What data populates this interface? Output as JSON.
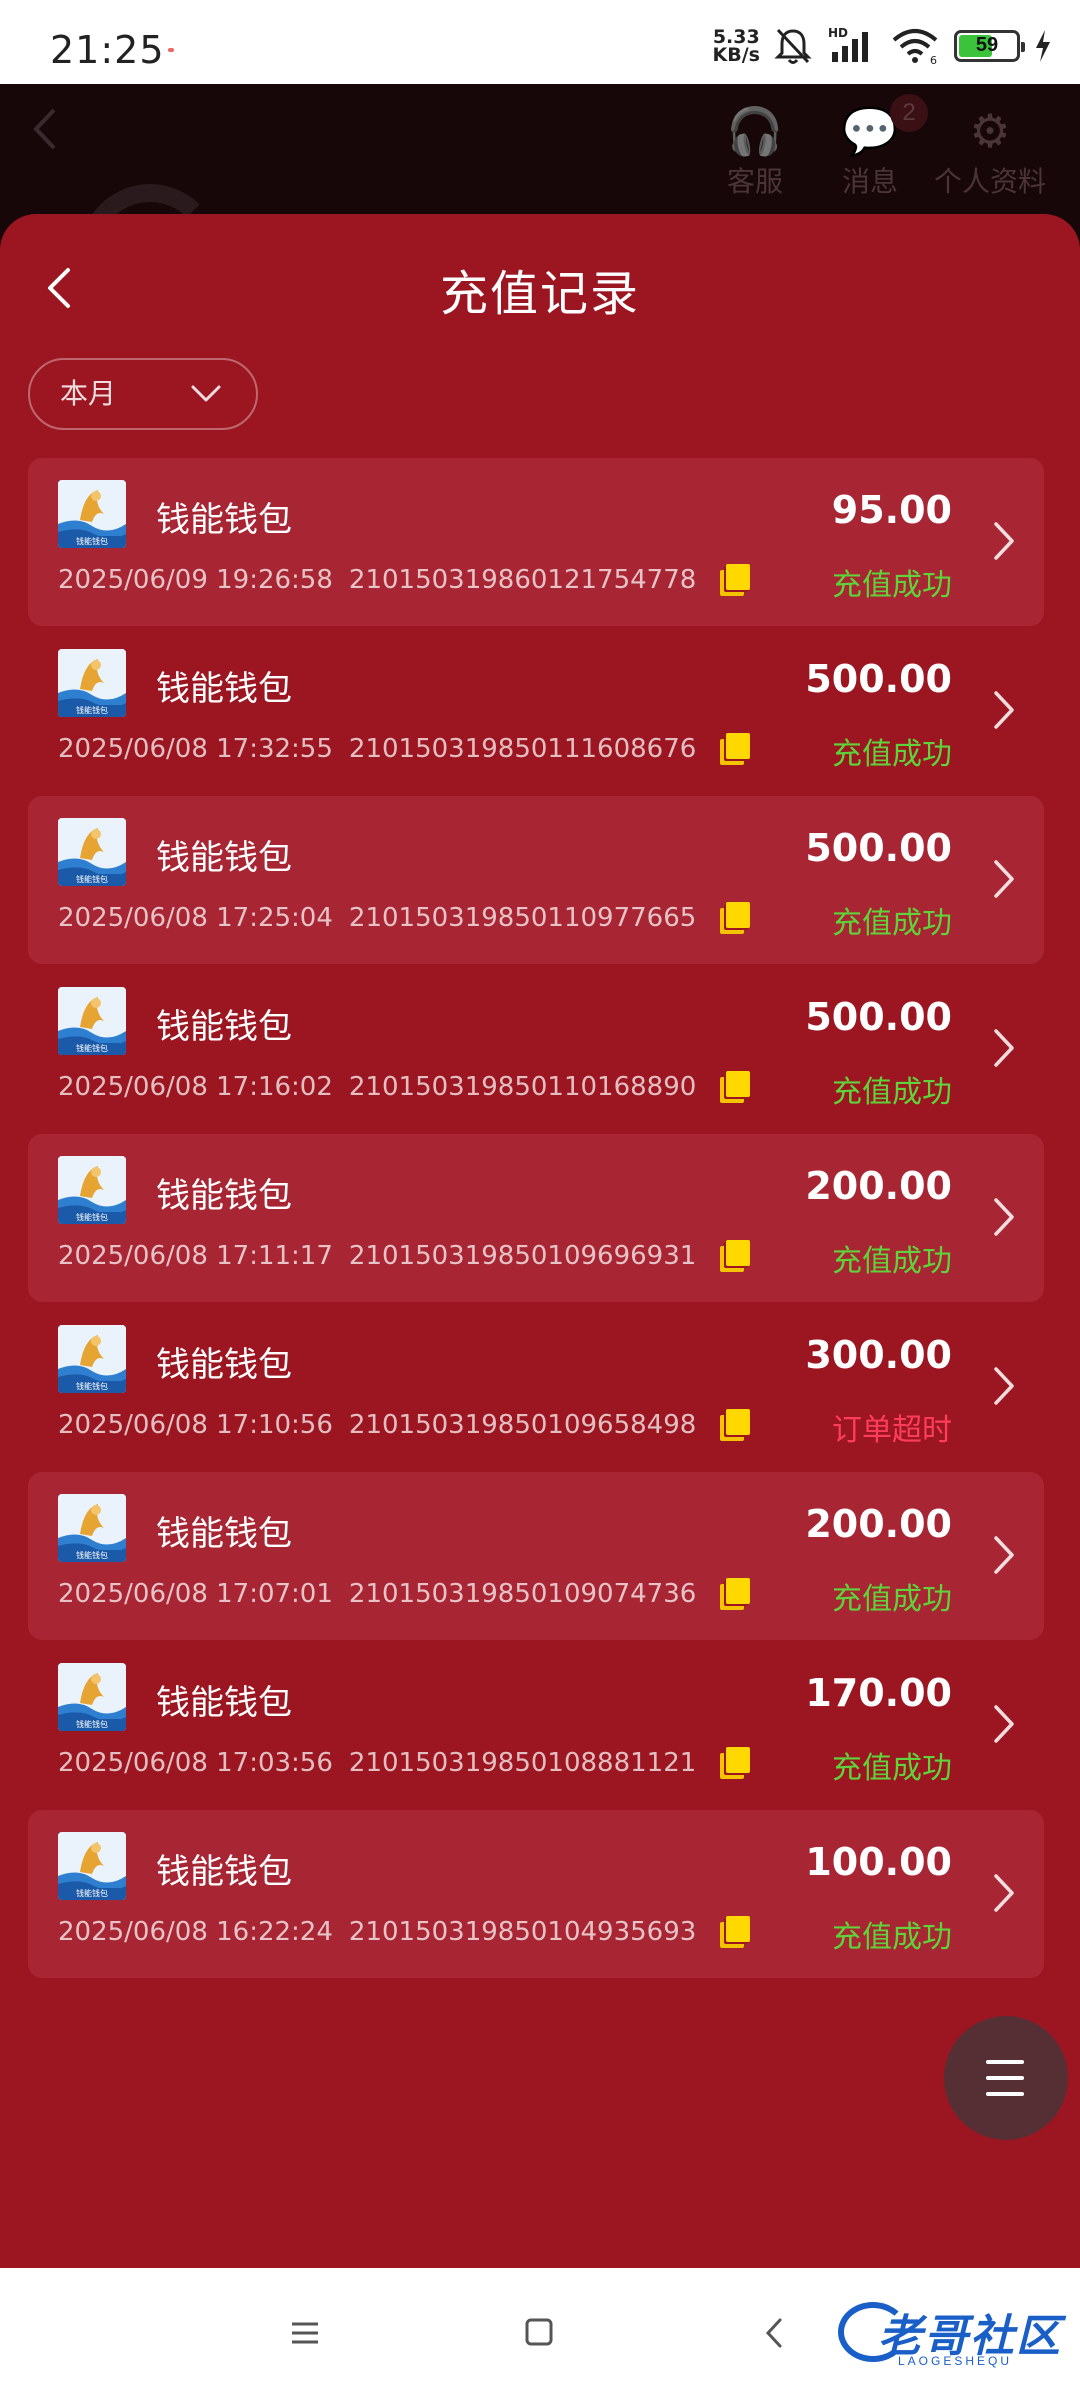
{
  "status_bar": {
    "time": "21:25",
    "net_speed_value": "5.33",
    "net_speed_unit": "KB/s",
    "hd_label": "HD",
    "battery_level": "59"
  },
  "background_page": {
    "customer_service_label": "客服",
    "messages_label": "消息",
    "messages_badge": "2",
    "profile_label": "个人资料"
  },
  "sheet": {
    "title": "充值记录",
    "filter_label": "本月"
  },
  "colors": {
    "sheet_bg": "#9c1622",
    "card_highlight": "#a82533",
    "success": "#5fd43a",
    "timeout": "#ff3d5a",
    "copy_icon": "#ffd800"
  },
  "records": [
    {
      "app_name": "钱能钱包",
      "datetime": "2025/06/09 19:26:58",
      "order_id": "210150319860121754778",
      "amount": "95.00",
      "status": "充值成功",
      "status_type": "success"
    },
    {
      "app_name": "钱能钱包",
      "datetime": "2025/06/08 17:32:55",
      "order_id": "210150319850111608676",
      "amount": "500.00",
      "status": "充值成功",
      "status_type": "success"
    },
    {
      "app_name": "钱能钱包",
      "datetime": "2025/06/08 17:25:04",
      "order_id": "210150319850110977665",
      "amount": "500.00",
      "status": "充值成功",
      "status_type": "success"
    },
    {
      "app_name": "钱能钱包",
      "datetime": "2025/06/08 17:16:02",
      "order_id": "210150319850110168890",
      "amount": "500.00",
      "status": "充值成功",
      "status_type": "success"
    },
    {
      "app_name": "钱能钱包",
      "datetime": "2025/06/08 17:11:17",
      "order_id": "210150319850109696931",
      "amount": "200.00",
      "status": "充值成功",
      "status_type": "success"
    },
    {
      "app_name": "钱能钱包",
      "datetime": "2025/06/08 17:10:56",
      "order_id": "210150319850109658498",
      "amount": "300.00",
      "status": "订单超时",
      "status_type": "timeout"
    },
    {
      "app_name": "钱能钱包",
      "datetime": "2025/06/08 17:07:01",
      "order_id": "210150319850109074736",
      "amount": "200.00",
      "status": "充值成功",
      "status_type": "success"
    },
    {
      "app_name": "钱能钱包",
      "datetime": "2025/06/08 17:03:56",
      "order_id": "210150319850108881121",
      "amount": "170.00",
      "status": "充值成功",
      "status_type": "success"
    },
    {
      "app_name": "钱能钱包",
      "datetime": "2025/06/08 16:22:24",
      "order_id": "210150319850104935693",
      "amount": "100.00",
      "status": "充值成功",
      "status_type": "success"
    }
  ],
  "icons": {
    "fab": "menu-icon",
    "nav_menu": "hamburger-icon",
    "nav_home": "square-icon",
    "nav_back": "back-chevron-icon"
  },
  "watermark": {
    "text": "老哥社区",
    "subtext": "LAOGESHEQU"
  }
}
